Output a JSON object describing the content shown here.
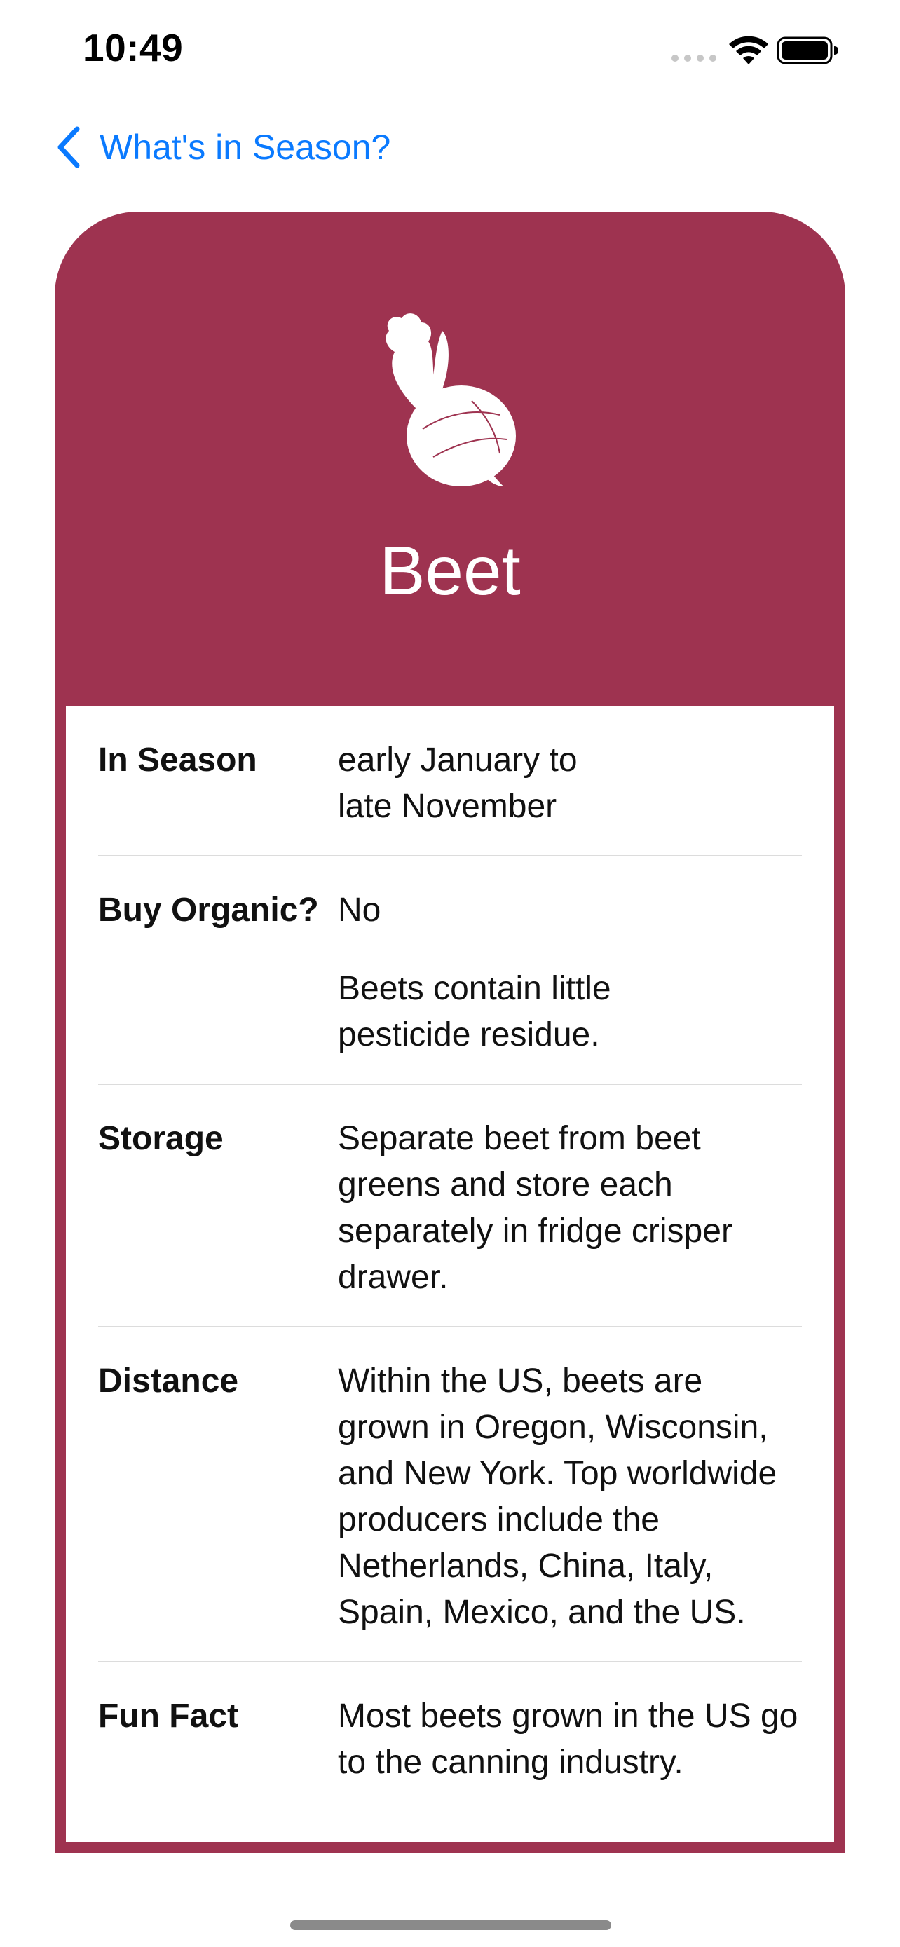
{
  "status_bar": {
    "time": "10:49"
  },
  "nav": {
    "back_label": "What's in Season?"
  },
  "produce": {
    "name": "Beet",
    "icon": "beet-icon",
    "accent_color": "#9e3350"
  },
  "details": [
    {
      "label": "In Season",
      "paragraphs": [
        "early January to late November"
      ]
    },
    {
      "label": "Buy Organic?",
      "paragraphs": [
        "No",
        "Beets contain little pesticide residue."
      ]
    },
    {
      "label": "Storage",
      "paragraphs": [
        "Separate beet from beet greens and store each separately in fridge crisper drawer."
      ]
    },
    {
      "label": "Distance",
      "paragraphs": [
        "Within the US, beets are grown in Oregon, Wisconsin, and New York. Top worldwide producers include the Netherlands, China, Italy, Spain, Mexico, and the US."
      ]
    },
    {
      "label": "Fun Fact",
      "paragraphs": [
        "Most beets grown in the US go to the canning industry."
      ]
    }
  ],
  "colors": {
    "link": "#0a7aff"
  }
}
